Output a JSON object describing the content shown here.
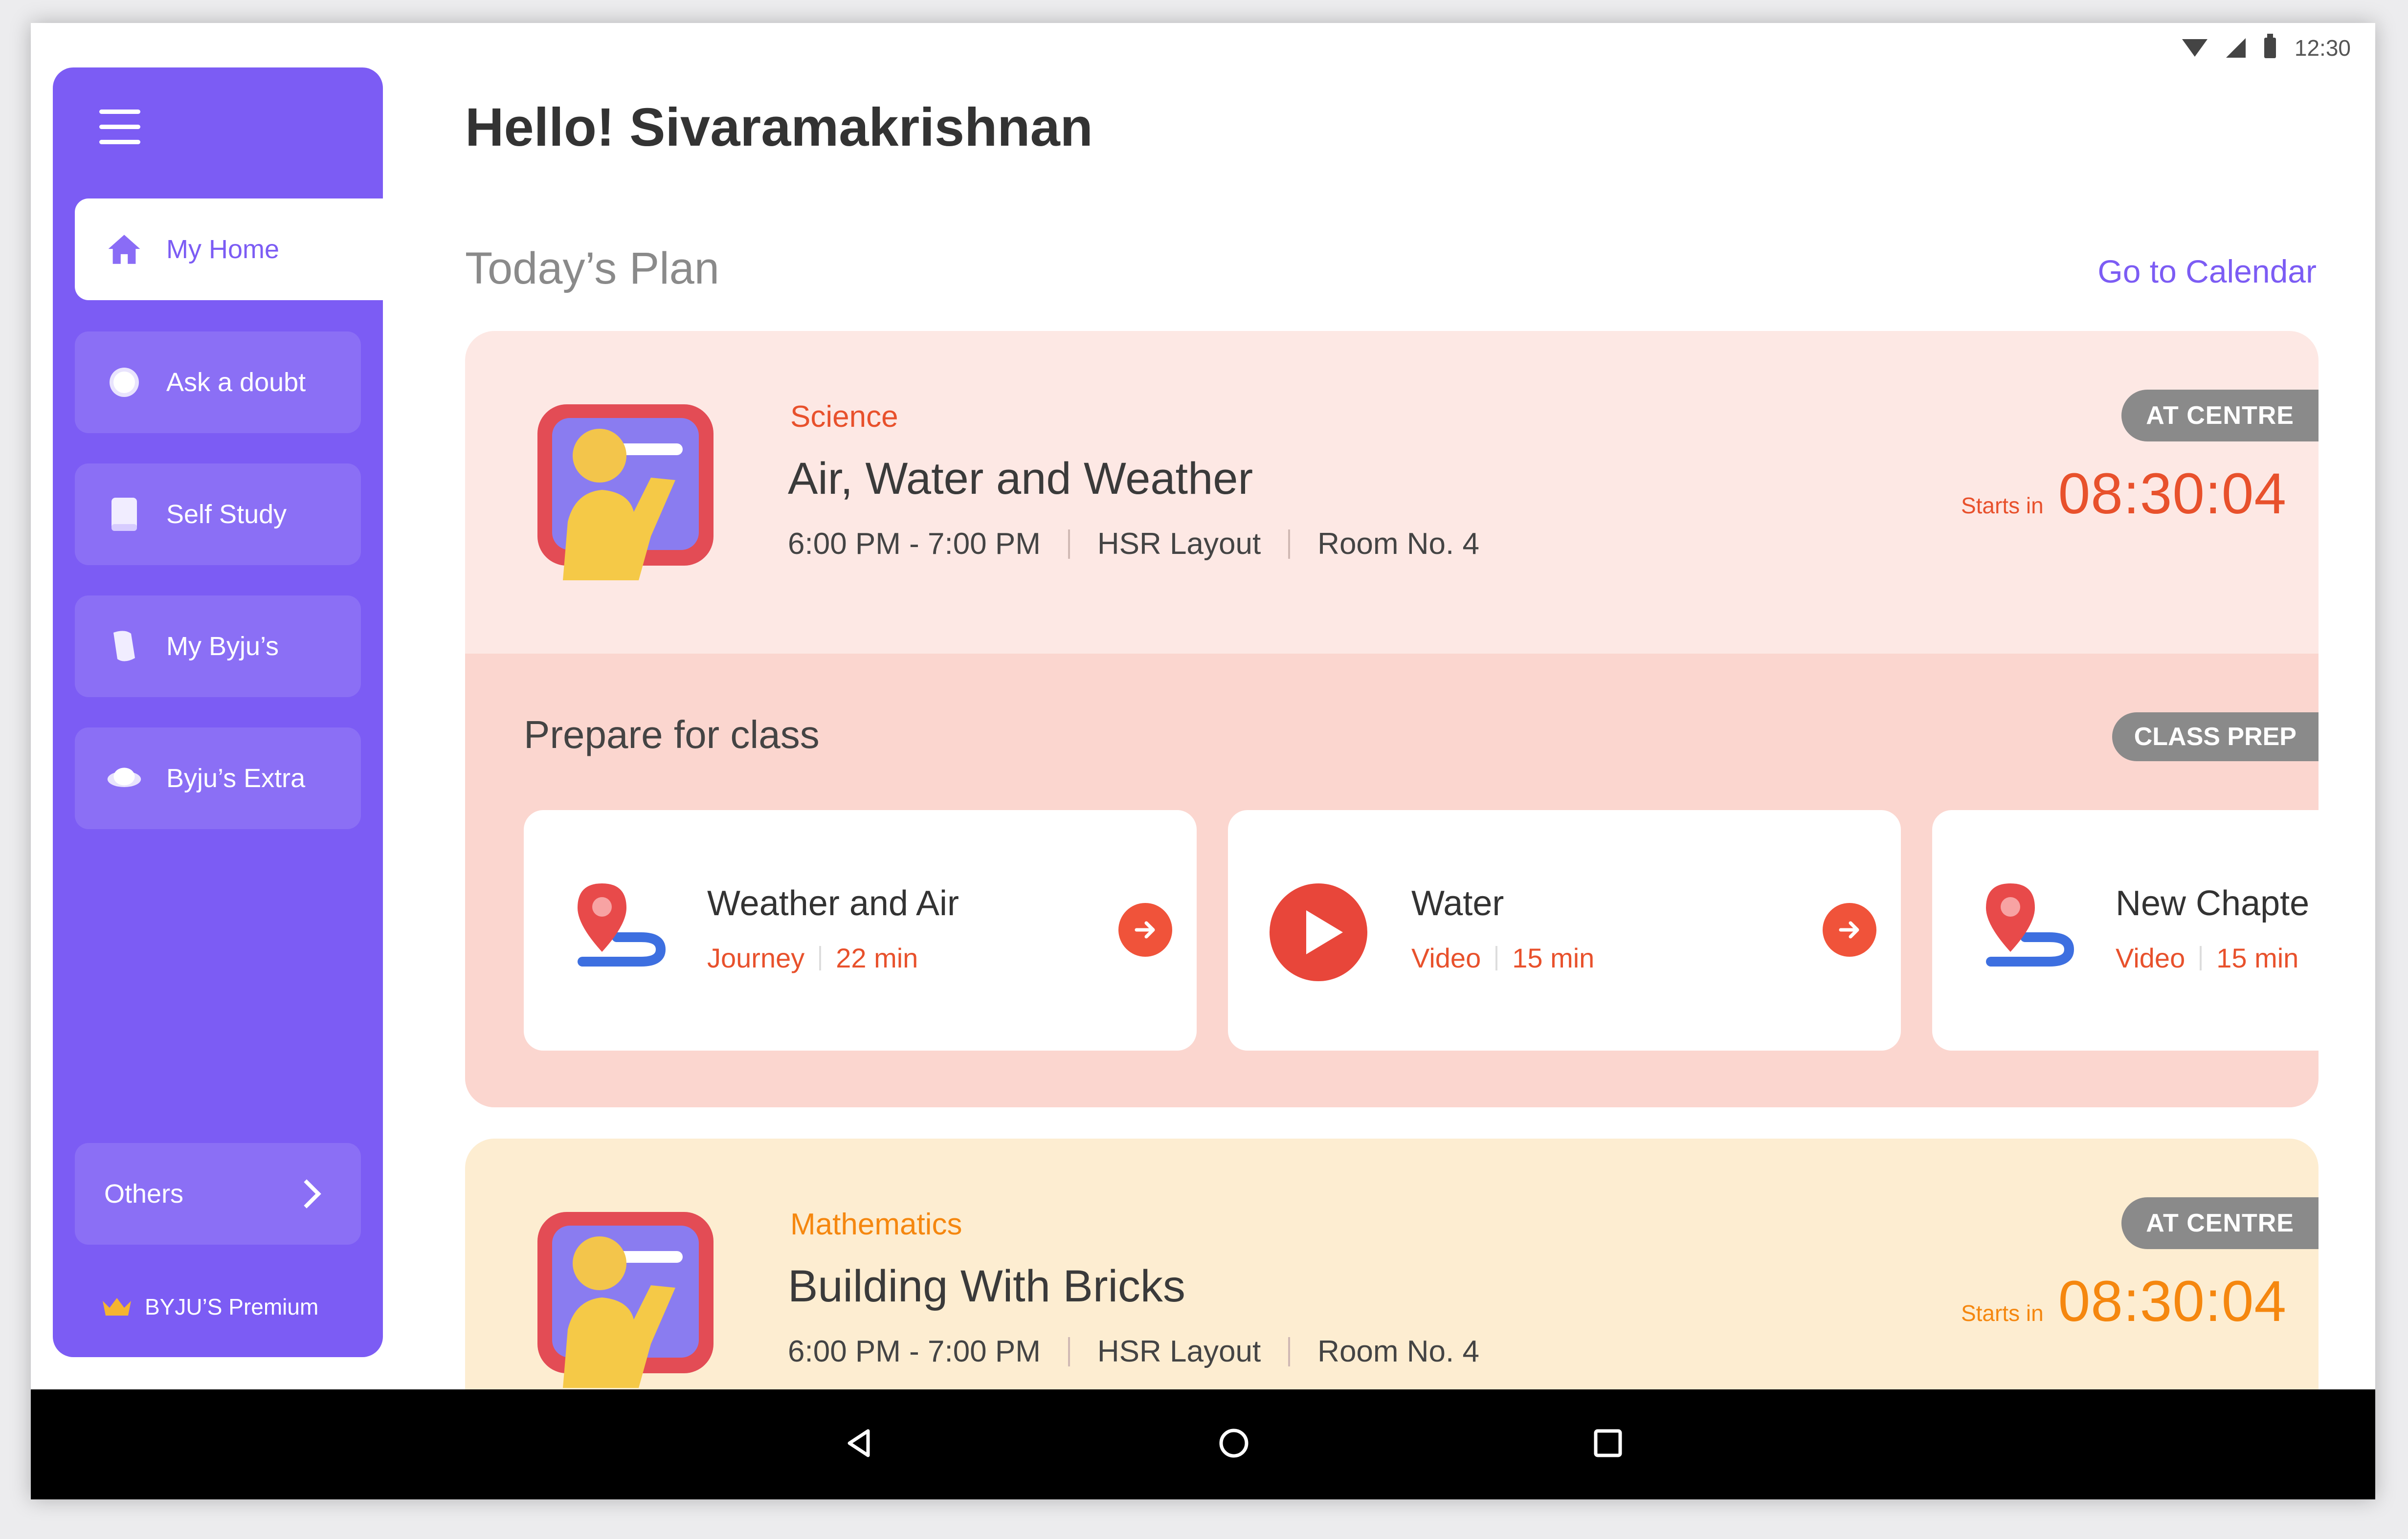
{
  "status_bar": {
    "time": "12:30"
  },
  "sidebar": {
    "items": [
      {
        "label": "My Home",
        "icon": "home-icon"
      },
      {
        "label": "Ask a doubt",
        "icon": "doubt-icon"
      },
      {
        "label": "Self Study",
        "icon": "book-icon"
      },
      {
        "label": "My Byju’s",
        "icon": "byjus-icon"
      },
      {
        "label": "Byju’s Extra",
        "icon": "extra-icon"
      }
    ],
    "others_label": "Others",
    "premium_label": "BYJU’S Premium"
  },
  "main": {
    "greeting": "Hello! Sivaramakrishnan",
    "plan_title": "Today’s Plan",
    "calendar_link": "Go to Calendar",
    "classes": [
      {
        "subject": "Science",
        "title": "Air, Water and Weather",
        "time": "6:00 PM - 7:00 PM",
        "location": "HSR Layout",
        "room": "Room No. 4",
        "badge": "AT CENTRE",
        "starts_label": "Starts in",
        "timer": "08:30:04",
        "accent": "#e8512c",
        "prep": {
          "title": "Prepare for class",
          "badge": "CLASS PREP",
          "resources": [
            {
              "title": "Weather and Air",
              "type": "Journey",
              "duration": "22 min",
              "icon": "journey-pin-icon"
            },
            {
              "title": "Water",
              "type": "Video",
              "duration": "15 min",
              "icon": "video-play-icon"
            },
            {
              "title": "New Chapte",
              "type": "Video",
              "duration": "15 min",
              "icon": "journey-pin-icon"
            }
          ]
        }
      },
      {
        "subject": "Mathematics",
        "title": "Building With Bricks",
        "time": "6:00 PM - 7:00 PM",
        "location": "HSR Layout",
        "room": "Room No. 4",
        "badge": "AT CENTRE",
        "starts_label": "Starts in",
        "timer": "08:30:04",
        "accent": "#f5870f"
      }
    ]
  },
  "colors": {
    "brand": "#7c5cf4",
    "science_bg": "#fde8e4",
    "prep_bg": "#fbd6cf",
    "math_bg": "#fdedd1",
    "arrow": "#f0533a"
  }
}
